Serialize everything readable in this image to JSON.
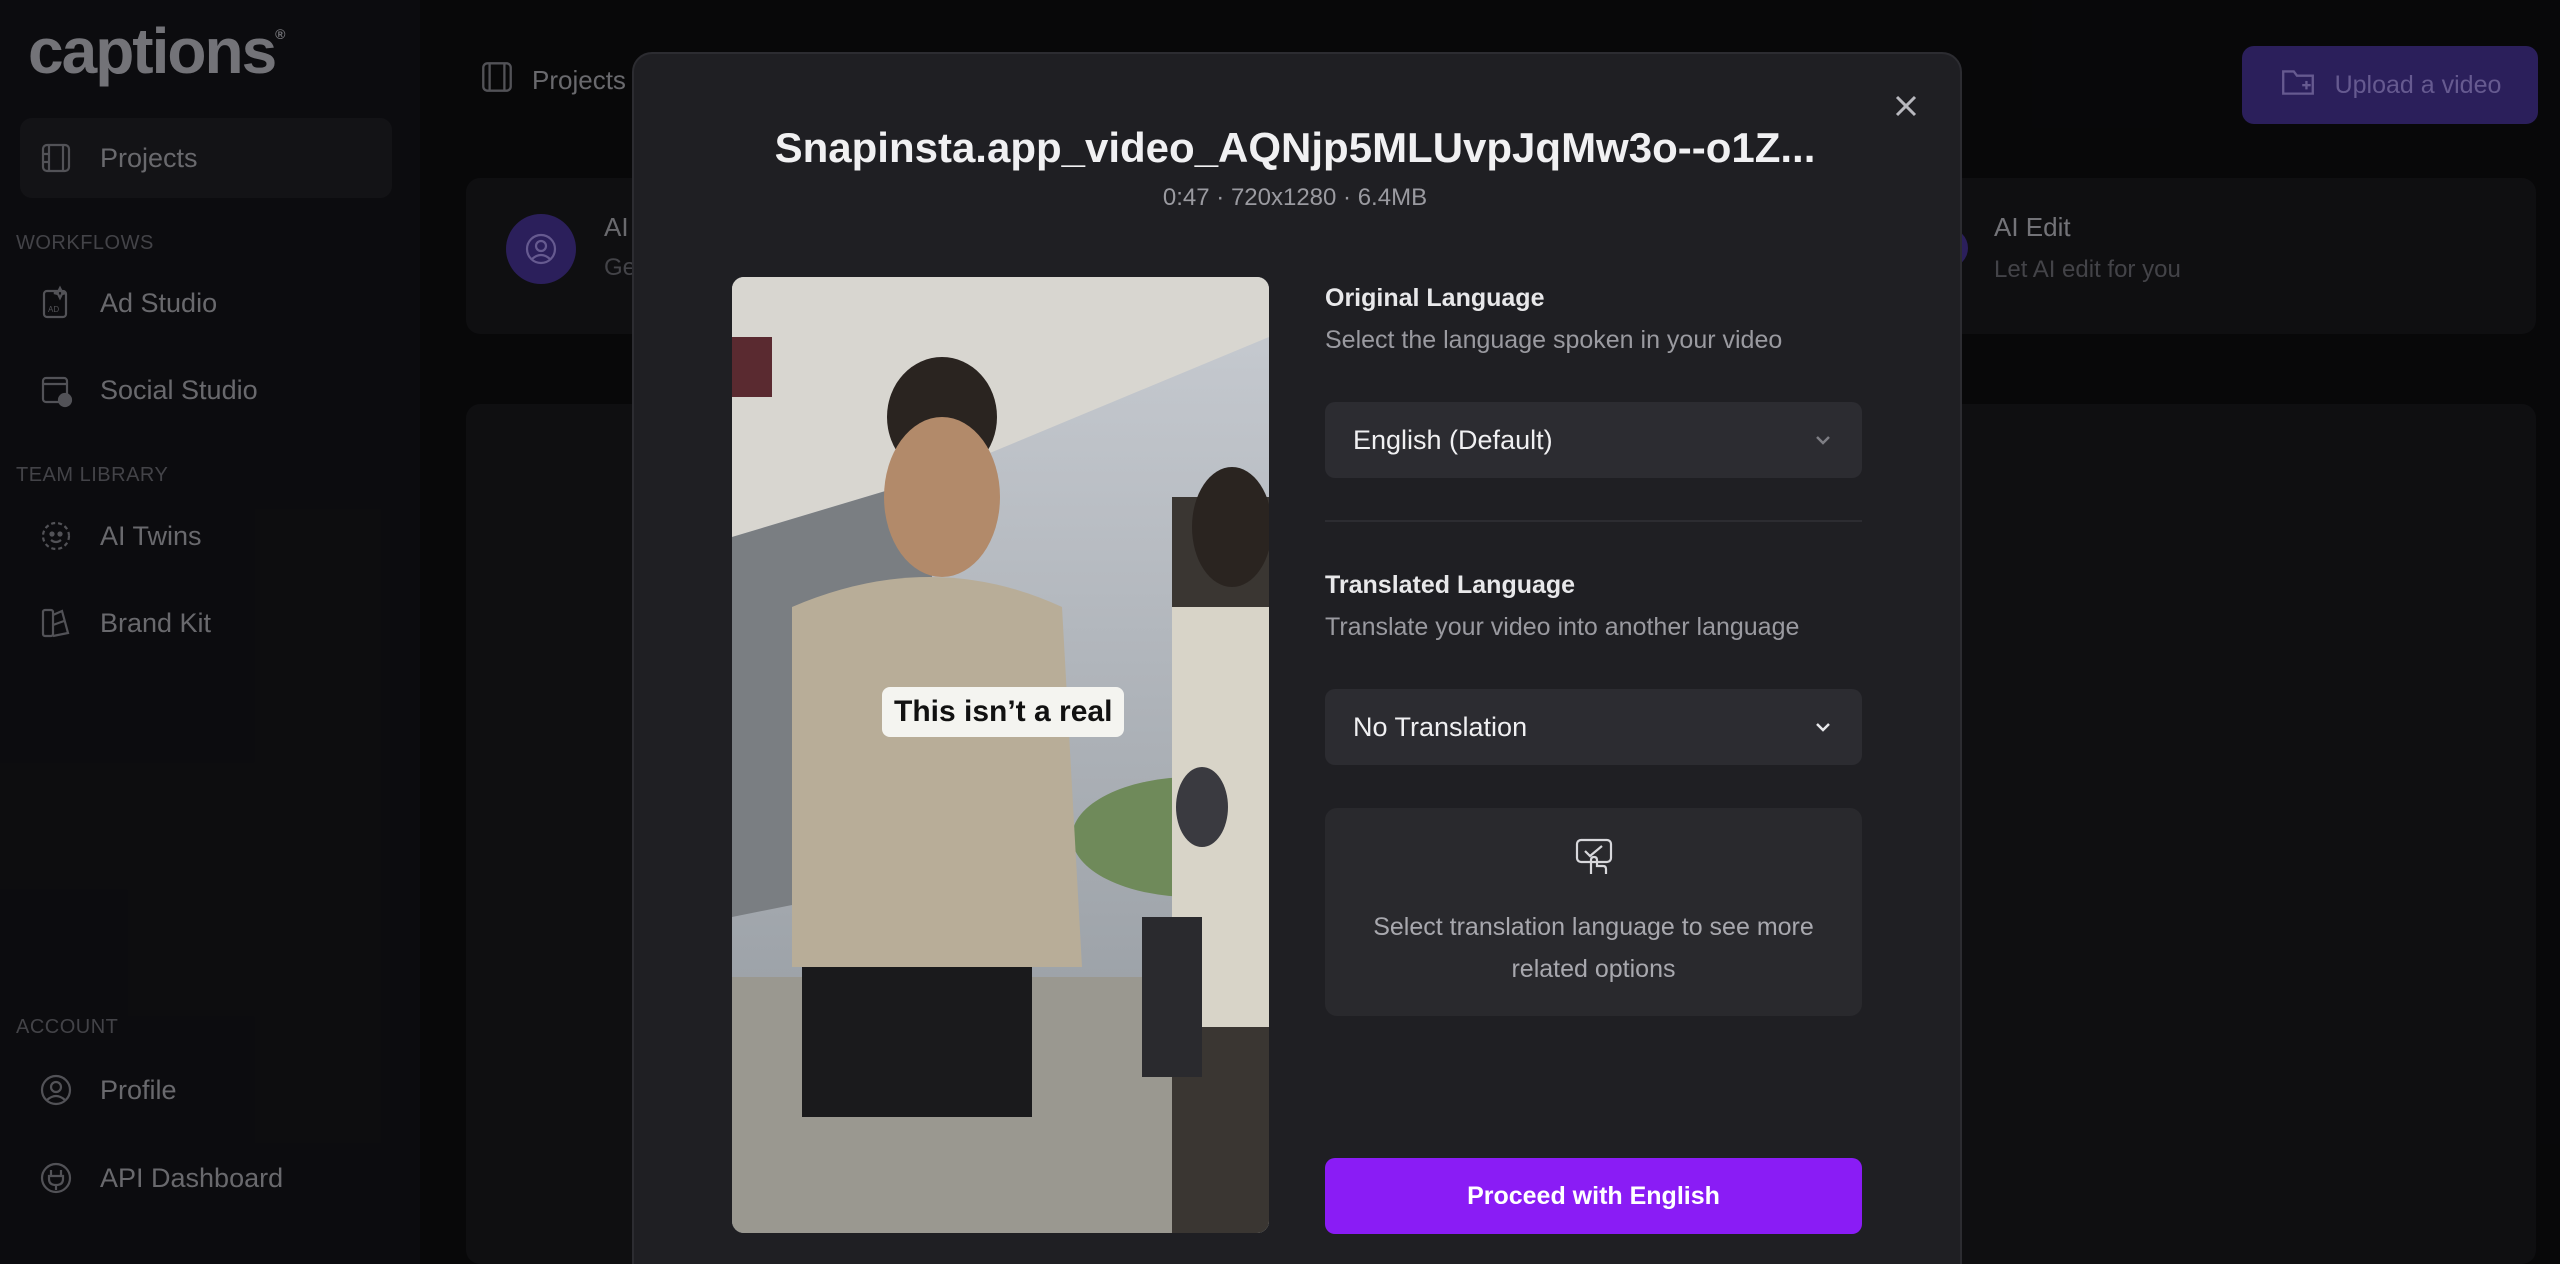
{
  "app": {
    "logo": "captions"
  },
  "sidebar": {
    "projects_label": "Projects",
    "workflows_section": "WORKFLOWS",
    "workflows": [
      {
        "label": "Ad Studio"
      },
      {
        "label": "Social Studio"
      }
    ],
    "team_section": "TEAM LIBRARY",
    "team": [
      {
        "label": "AI Twins"
      },
      {
        "label": "Brand Kit"
      }
    ],
    "account_section": "ACCOUNT",
    "account": [
      {
        "label": "Profile"
      },
      {
        "label": "API Dashboard"
      }
    ]
  },
  "main": {
    "breadcrumb": "Projects",
    "upload_label": "Upload a video",
    "card_left_title": "AI",
    "card_left_sub": "Ge",
    "ai_edit_title": "AI Edit",
    "ai_edit_sub": "Let AI edit for you"
  },
  "modal": {
    "title": "Snapinsta.app_video_AQNjp5MLUvpJqMw3o--o1Z...",
    "meta": "0:47 · 720x1280 · 6.4MB",
    "video_caption": "This isn’t a real",
    "original": {
      "title": "Original Language",
      "subtitle": "Select the language spoken in your video",
      "selected": "English (Default)"
    },
    "translated": {
      "title": "Translated Language",
      "subtitle": "Translate your video into another language",
      "selected": "No Translation"
    },
    "info_text": "Select translation language to see more related options",
    "proceed_label": "Proceed with English"
  },
  "colors": {
    "accent": "#8a1cf5",
    "modal_bg": "#1f1f23",
    "page_bg": "#0b0b0d"
  },
  "icons": [
    "projects-icon",
    "ad-studio-icon",
    "social-studio-icon",
    "ai-twins-icon",
    "brand-kit-icon",
    "profile-icon",
    "api-dashboard-icon",
    "upload-folder-icon",
    "close-icon",
    "chevron-down-icon",
    "translate-touch-icon"
  ]
}
